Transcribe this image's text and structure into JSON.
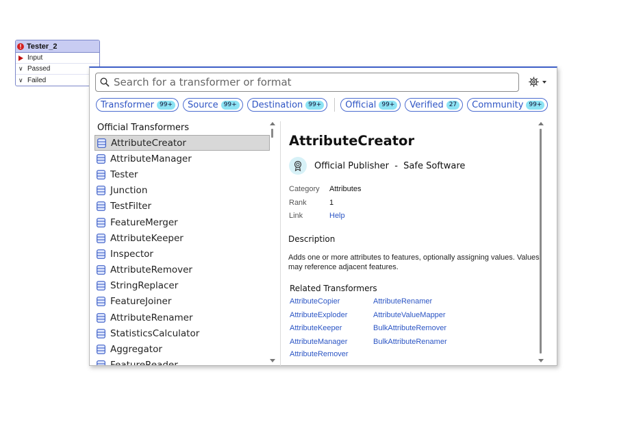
{
  "node": {
    "title": "Tester_2",
    "ports": [
      {
        "label": "Input",
        "kind": "input"
      },
      {
        "label": "Passed",
        "kind": "output"
      },
      {
        "label": "Failed",
        "kind": "output"
      }
    ]
  },
  "search": {
    "placeholder": "Search for a transformer or format",
    "value": ""
  },
  "filters": [
    {
      "label": "Transformer",
      "count": "99+"
    },
    {
      "label": "Source",
      "count": "99+"
    },
    {
      "label": "Destination",
      "count": "99+"
    },
    {
      "label": "Official",
      "count": "99+"
    },
    {
      "label": "Verified",
      "count": "27"
    },
    {
      "label": "Community",
      "count": "99+"
    }
  ],
  "list": {
    "title": "Official Transformers",
    "items": [
      "AttributeCreator",
      "AttributeManager",
      "Tester",
      "Junction",
      "TestFilter",
      "FeatureMerger",
      "AttributeKeeper",
      "Inspector",
      "AttributeRemover",
      "StringReplacer",
      "FeatureJoiner",
      "AttributeRenamer",
      "StatisticsCalculator",
      "Aggregator",
      "FeatureReader"
    ],
    "selected_index": 0
  },
  "detail": {
    "title": "AttributeCreator",
    "publisher": "Official Publisher  -  Safe Software",
    "meta": [
      {
        "key": "Category",
        "value": "Attributes"
      },
      {
        "key": "Rank",
        "value": "1"
      },
      {
        "key": "Link",
        "value": "Help"
      }
    ],
    "description_heading": "Description",
    "description": "Adds one or more attributes to features, optionally assigning values. Values may reference adjacent features.",
    "related_heading": "Related Transformers",
    "related": [
      "AttributeCopier",
      "AttributeRenamer",
      "AttributeExploder",
      "AttributeValueMapper",
      "AttributeKeeper",
      "BulkAttributeRemover",
      "AttributeManager",
      "BulkAttributeRenamer",
      "AttributeRemover"
    ]
  },
  "colors": {
    "accent": "#3d5fc7",
    "chip_badge": "#8de3f4",
    "link": "#2b55c4",
    "error": "#d42020"
  }
}
